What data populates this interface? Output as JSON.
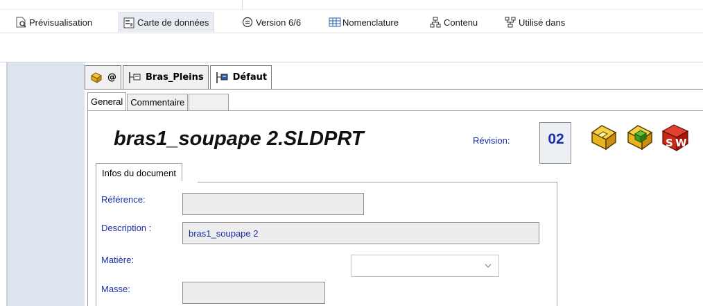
{
  "tabs": [
    {
      "label": "Prévisualisation",
      "icon": "preview-icon"
    },
    {
      "label": "Carte de données",
      "icon": "datacard-icon",
      "active": true
    },
    {
      "label": "Version 6/6",
      "icon": "version-icon"
    },
    {
      "label": "Nomenclature",
      "icon": "bom-icon"
    },
    {
      "label": "Contenu",
      "icon": "contains-icon"
    },
    {
      "label": "Utilisé dans",
      "icon": "where-used-icon"
    }
  ],
  "config_tabs": [
    {
      "label": "@",
      "icon": "part-config-icon"
    },
    {
      "label": "Bras_Pleins",
      "icon": "configuration-icon"
    },
    {
      "label": "Défaut",
      "icon": "configuration-icon",
      "active": true
    }
  ],
  "sub_tabs": [
    {
      "label": "General",
      "active": true
    },
    {
      "label": "Commentaire"
    },
    {
      "label": ""
    }
  ],
  "document": {
    "title": "bras1_soupape 2.SLDPRT",
    "revision_label": "Révision:",
    "revision_value": "02"
  },
  "right_icons": [
    "part-icon",
    "part-green-icon",
    "solidworks-icon"
  ],
  "info_section": {
    "tab_label": "Infos du document",
    "fields": {
      "reference": {
        "label": "Référence:",
        "value": ""
      },
      "description": {
        "label": "Description :",
        "value": "bras1_soupape 2"
      },
      "material": {
        "label": "Matière:",
        "value": ""
      },
      "mass": {
        "label": "Masse:",
        "value": ""
      }
    }
  },
  "colors": {
    "label_blue": "#1a2ea8",
    "active_tab_bg": "#e9edf3",
    "side_panel": "#dce4ef"
  }
}
